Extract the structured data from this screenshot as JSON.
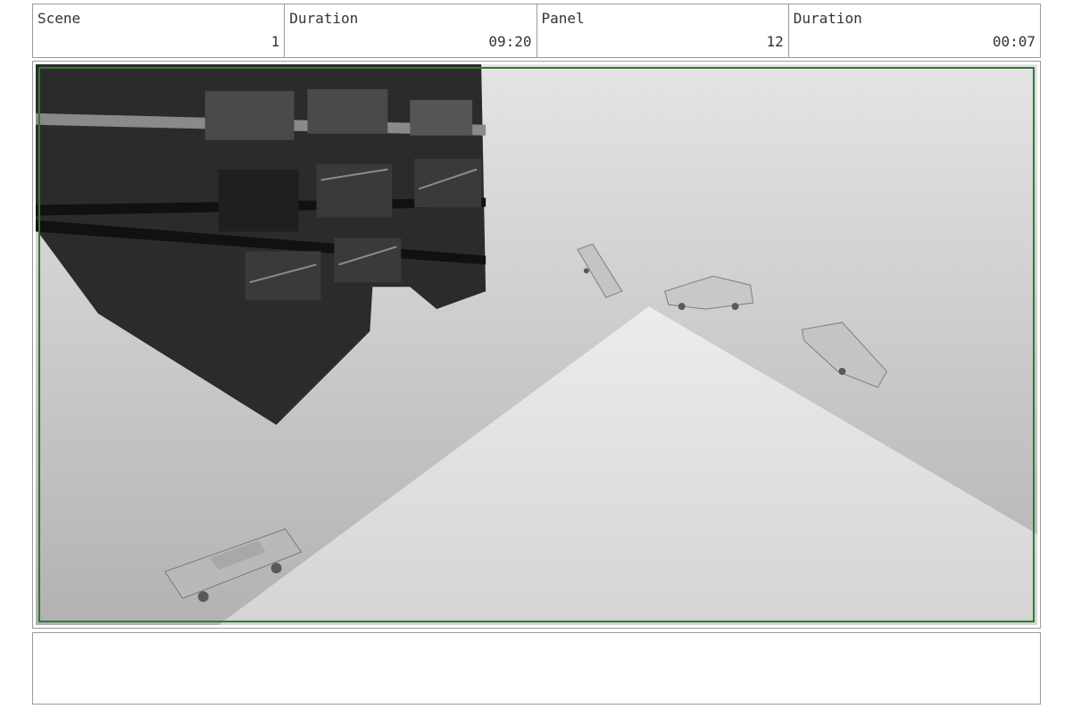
{
  "header": {
    "fields": [
      {
        "label": "Scene",
        "value": "1"
      },
      {
        "label": "Duration",
        "value": "09:20"
      },
      {
        "label": "Panel",
        "value": "12"
      },
      {
        "label": "Duration",
        "value": "00:07"
      }
    ]
  },
  "panel": {
    "safe_frame_color": "#2f7a2f",
    "scene_elements": [
      "building",
      "car",
      "car",
      "car",
      "car",
      "spotlight-cone"
    ]
  },
  "notes": {
    "text": ""
  }
}
